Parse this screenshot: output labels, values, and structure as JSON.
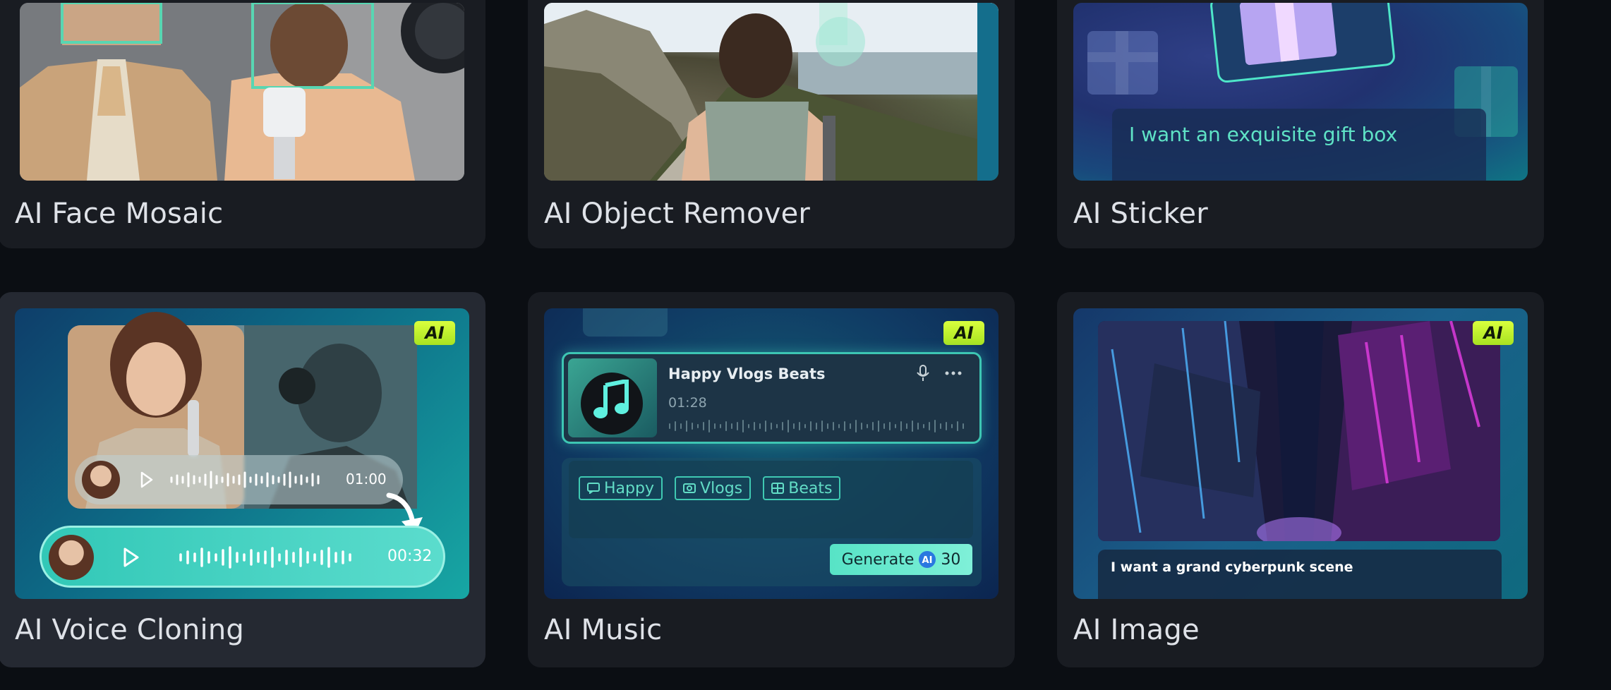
{
  "cards": [
    {
      "title": "AI Face Mosaic"
    },
    {
      "title": "AI Object Remover"
    },
    {
      "title": "AI Sticker",
      "prompt_text": "I want an exquisite gift box"
    },
    {
      "title": "AI Voice Cloning",
      "badge": "AI",
      "clip_small_time": "01:00",
      "clip_large_time": "00:32"
    },
    {
      "title": "AI Music",
      "badge": "AI",
      "track_name": "Happy Vlogs Beats",
      "track_time": "01:28",
      "tags": [
        "Happy",
        "Vlogs",
        "Beats"
      ],
      "generate_label": "Generate",
      "generate_credits": "30"
    },
    {
      "title": "AI Image",
      "badge": "AI",
      "prompt_text": "I want a grand cyberpunk scene"
    }
  ]
}
